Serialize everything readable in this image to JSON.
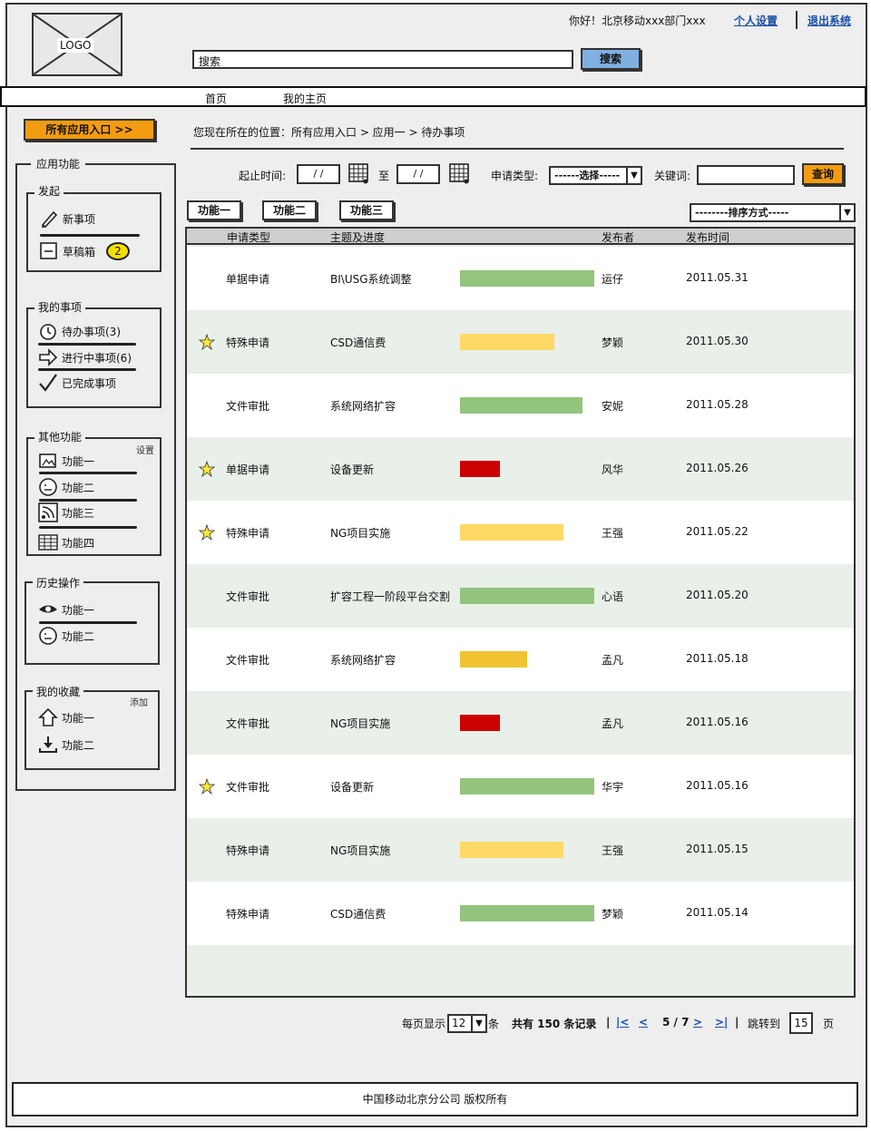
{
  "header": {
    "logo": "LOGO",
    "greeting": "你好！北京移动xxx部门xxx",
    "settings_link": "个人设置",
    "logout_link": "退出系统",
    "search_value": "搜索",
    "search_button": "搜索"
  },
  "nav": {
    "home": "首页",
    "my_home": "我的主页"
  },
  "all_apps_button": "所有应用入口 >>",
  "breadcrumb": "您现在所在的位置：所有应用入口 > 应用一 > 待办事项",
  "sidebar": {
    "title": "应用功能",
    "start": {
      "title": "发起",
      "new_item": "新事项",
      "drafts": "草稿箱",
      "drafts_count": "2"
    },
    "my_items": {
      "title": "我的事项",
      "todo": "待办事项(3)",
      "in_progress": "进行中事项(6)",
      "done": "已完成事项"
    },
    "other": {
      "title": "其他功能",
      "settings": "设置",
      "f1": "功能一",
      "f2": "功能二",
      "f3": "功能三",
      "f4": "功能四"
    },
    "history": {
      "title": "历史操作",
      "f1": "功能一",
      "f2": "功能二"
    },
    "favorites": {
      "title": "我的收藏",
      "add": "添加",
      "f1": "功能一",
      "f2": "功能二"
    }
  },
  "filters": {
    "date_label": "起止时间:",
    "date_start": "/ /",
    "to_label": "至",
    "date_end": "/ /",
    "type_label": "申请类型:",
    "type_value": "------选择-----",
    "keyword_label": "关键词:",
    "keyword_value": "",
    "query_button": "查询"
  },
  "func_buttons": [
    "功能一",
    "功能二",
    "功能三"
  ],
  "sort_select": "--------排序方式-----",
  "table": {
    "headers": [
      "申请类型",
      "主题及进度",
      "发布者",
      "发布时间"
    ],
    "rows": [
      {
        "type": "单据申请",
        "subject": "BI\\USG系统调整",
        "progress": 1.0,
        "color": "#93c47d",
        "publisher": "运仔",
        "date": "2011.05.31",
        "star": false
      },
      {
        "type": "特殊申请",
        "subject": "CSD通信费",
        "progress": 0.7,
        "color": "#ffd966",
        "publisher": "梦颖",
        "date": "2011.05.30",
        "star": true
      },
      {
        "type": "文件审批",
        "subject": "系统网络扩容",
        "progress": 0.91,
        "color": "#93c47d",
        "publisher": "安妮",
        "date": "2011.05.28",
        "star": false
      },
      {
        "type": "单据申请",
        "subject": "设备更新",
        "progress": 0.3,
        "color": "#cc0000",
        "publisher": "风华",
        "date": "2011.05.26",
        "star": true
      },
      {
        "type": "特殊申请",
        "subject": "NG项目实施",
        "progress": 0.77,
        "color": "#ffd966",
        "publisher": "王强",
        "date": "2011.05.22",
        "star": true
      },
      {
        "type": "文件审批",
        "subject": "扩容工程一阶段平台交割",
        "progress": 1.0,
        "color": "#93c47d",
        "publisher": "心语",
        "date": "2011.05.20",
        "star": false
      },
      {
        "type": "文件审批",
        "subject": "系统网络扩容",
        "progress": 0.5,
        "color": "#f1c232",
        "publisher": "孟凡",
        "date": "2011.05.18",
        "star": false
      },
      {
        "type": "文件审批",
        "subject": "NG项目实施",
        "progress": 0.3,
        "color": "#cc0000",
        "publisher": "孟凡",
        "date": "2011.05.16",
        "star": false
      },
      {
        "type": "文件审批",
        "subject": "设备更新",
        "progress": 1.0,
        "color": "#93c47d",
        "publisher": "华宇",
        "date": "2011.05.16",
        "star": true
      },
      {
        "type": "特殊申请",
        "subject": "NG项目实施",
        "progress": 0.77,
        "color": "#ffd966",
        "publisher": "王强",
        "date": "2011.05.15",
        "star": false
      },
      {
        "type": "特殊申请",
        "subject": "CSD通信费",
        "progress": 1.0,
        "color": "#93c47d",
        "publisher": "梦颖",
        "date": "2011.05.14",
        "star": false
      }
    ]
  },
  "pager": {
    "per_page_label": "每页显示",
    "per_page_value": "12",
    "unit": "条",
    "total": "共有 150 条记录",
    "sep": "|",
    "first": "|<",
    "prev": "<",
    "page": "5 / 7",
    "next": ">",
    "last": ">|",
    "jump_label": "跳转到",
    "jump_value": "15",
    "page_unit": "页"
  },
  "footer": "中国移动北京分公司 版权所有"
}
